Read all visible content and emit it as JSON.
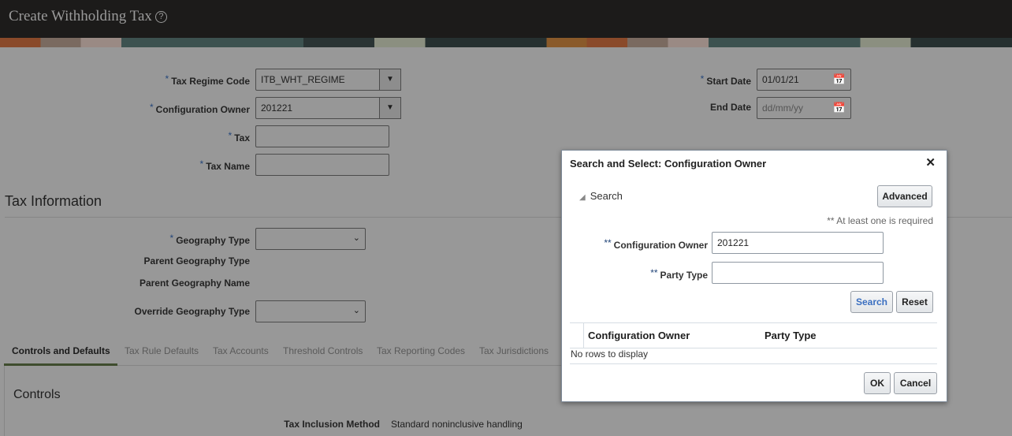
{
  "header": {
    "title": "Create Withholding Tax",
    "help_icon": "?"
  },
  "form": {
    "tax_regime_code": {
      "label": "Tax Regime Code",
      "value": "ITB_WHT_REGIME"
    },
    "configuration_owner": {
      "label": "Configuration Owner",
      "value": "201221"
    },
    "tax": {
      "label": "Tax",
      "value": ""
    },
    "tax_name": {
      "label": "Tax Name",
      "value": ""
    },
    "start_date": {
      "label": "Start Date",
      "value": "01/01/21"
    },
    "end_date": {
      "label": "End Date",
      "placeholder": "dd/mm/yy"
    },
    "required_mark": "*"
  },
  "tax_information": {
    "title": "Tax Information",
    "geography_type": "Geography Type",
    "parent_geography_type": "Parent Geography Type",
    "parent_geography_name": "Parent Geography Name",
    "override_geography_type": "Override Geography Type"
  },
  "tabs": [
    "Controls and Defaults",
    "Tax Rule Defaults",
    "Tax Accounts",
    "Threshold Controls",
    "Tax Reporting Codes",
    "Tax Jurisdictions"
  ],
  "controls": {
    "title": "Controls",
    "tax_inclusion_label": "Tax Inclusion Method",
    "tax_inclusion_value": "Standard noninclusive handling"
  },
  "dialog": {
    "title": "Search and Select: Configuration Owner",
    "close": "✕",
    "search_label": "Search",
    "advanced": "Advanced",
    "hint": "** At least one is required",
    "req_mark": "**",
    "config_owner_label": "Configuration Owner",
    "config_owner_value": "201221",
    "party_type_label": "Party Type",
    "party_type_value": "",
    "search_btn": "Search",
    "reset_btn": "Reset",
    "columns": [
      "Configuration Owner",
      "Party Type"
    ],
    "empty": "No rows to display",
    "ok": "OK",
    "cancel": "Cancel"
  }
}
